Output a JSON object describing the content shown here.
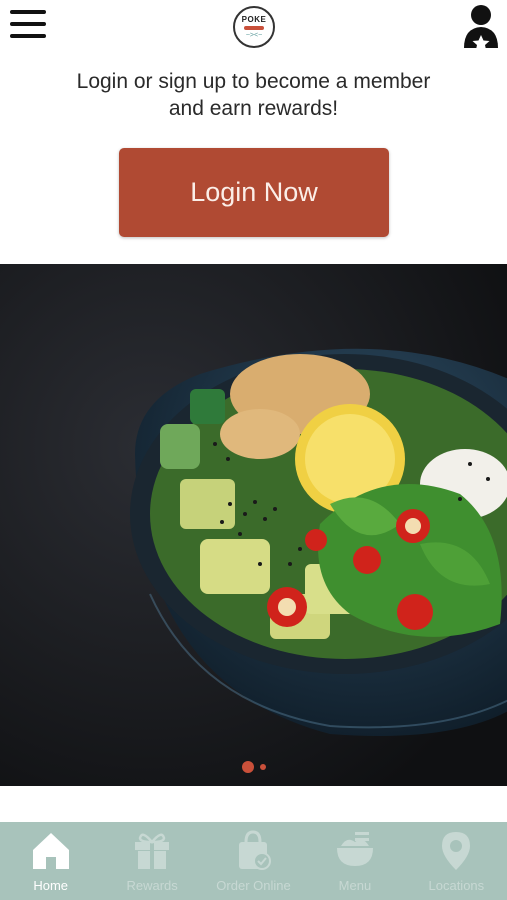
{
  "header": {
    "logo": {
      "top": "POKE",
      "bottom": "~><~"
    }
  },
  "prompt": {
    "line1": "Login or sign up to become a member",
    "line2": "and earn rewards!"
  },
  "login_button": {
    "label": "Login Now"
  },
  "carousel": {
    "current_slide": 1,
    "total_slides": 2
  },
  "tabs": [
    {
      "label": "Home",
      "icon": "home-icon",
      "active": true
    },
    {
      "label": "Rewards",
      "icon": "gift-icon",
      "active": false
    },
    {
      "label": "Order Online",
      "icon": "shopping-bag-icon",
      "active": false
    },
    {
      "label": "Menu",
      "icon": "bowl-icon",
      "active": false
    },
    {
      "label": "Locations",
      "icon": "location-pin-icon",
      "active": false
    }
  ],
  "colors": {
    "accent": "#b04a33",
    "tabbar": "#a8c3bb",
    "tab_active": "#ffffff",
    "tab_inactive": "#c7d8d3"
  }
}
